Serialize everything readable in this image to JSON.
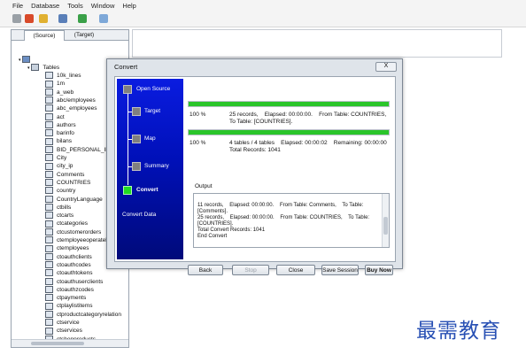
{
  "menu": [
    "File",
    "Database",
    "Tools",
    "Window",
    "Help"
  ],
  "left_panel": {
    "tabs": [
      "(Source)",
      "(Target)"
    ],
    "root_label": "Tables",
    "tables": [
      "10k_lines",
      "1m",
      "a_web",
      "abc/employees",
      "abc_employees",
      "act",
      "authors",
      "barinfo",
      "bilans",
      "BID_PERSONAL_INF",
      "City",
      "city_ip",
      "Comments",
      "COUNTRIES",
      "country",
      "CountryLanguage",
      "ctbills",
      "ctcarts",
      "ctcategories",
      "ctcustomerorders",
      "ctemployeeoperatelog",
      "ctemployees",
      "ctoauthclients",
      "ctoauthcodes",
      "ctoauthtokens",
      "ctoauthuserclients",
      "ctoauthzcodes",
      "ctpayments",
      "ctplaylistitems",
      "ctproductcategoryrelation",
      "ctservice",
      "ctservices",
      "ctshopproducts"
    ]
  },
  "dialog": {
    "title": "Convert",
    "close_label": "X",
    "steps": [
      "Open Source",
      "Target",
      "Map",
      "Summary",
      "Convert"
    ],
    "footer_label": "Convert Data",
    "progress1": {
      "percent": "100 %",
      "value": 1.0,
      "text": "25 records,    Elapsed: 00:00:00.    From Table: COUNTRIES,",
      "text2": "To Table: [COUNTRIES]."
    },
    "progress2": {
      "percent": "100 %",
      "value": 1.0,
      "text": "4 tables / 4 tables    Elapsed: 00:00:02    Remaining: 00:00:00",
      "text2": "Total Records: 1041"
    },
    "output_label": "Output",
    "output_lines": [
      "11 records,    Elapsed: 00:00:00.    From Table: Comments,    To Table:",
      "[Comments].",
      "25 records,    Elapsed: 00:00:00.    From Table: COUNTRIES,    To Table:",
      "[COUNTRIES].",
      "Total Convert Records: 1041",
      "End Convert"
    ],
    "buttons": {
      "back": "Back",
      "stop": "Stop",
      "close": "Close",
      "save_session": "Save Session",
      "buy_now": "Buy Now"
    }
  },
  "watermark": "最需教育",
  "colors": {
    "progress_green": "#2ac52a",
    "active_step": "#22dd22",
    "step_panel": "#0010b8"
  }
}
